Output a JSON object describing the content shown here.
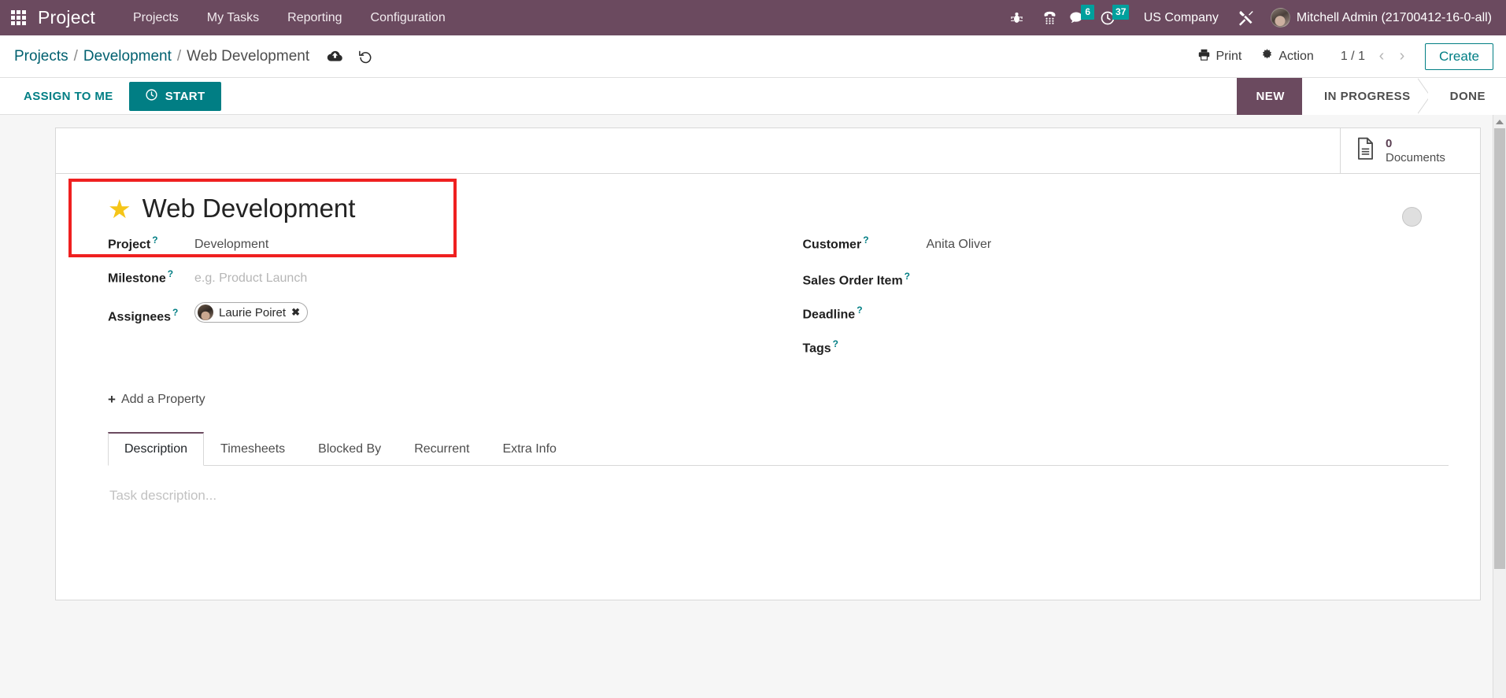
{
  "navbar": {
    "apps_icon": "apps-grid-icon",
    "brand": "Project",
    "menu_items": [
      {
        "label": "Projects"
      },
      {
        "label": "My Tasks"
      },
      {
        "label": "Reporting"
      },
      {
        "label": "Configuration"
      }
    ],
    "icons": [
      {
        "name": "bug-icon"
      },
      {
        "name": "dialpad-icon"
      }
    ],
    "messages_badge": "6",
    "activities_badge": "37",
    "company": "US Company",
    "tools_icon": "tools-icon",
    "user": "Mitchell Admin (21700412-16-0-all)",
    "colors": {
      "background": "#6b4a5f",
      "badge": "#00a09d"
    }
  },
  "control_panel": {
    "breadcrumb": [
      {
        "label": "Projects",
        "link": true
      },
      {
        "label": "Development",
        "link": true
      },
      {
        "label": "Web Development",
        "link": false
      }
    ],
    "separator": "/",
    "save_icon": "cloud-upload-icon",
    "discard_icon": "undo-icon",
    "print_label": "Print",
    "print_icon": "printer-icon",
    "action_label": "Action",
    "action_icon": "gear-icon",
    "pager": "1 / 1",
    "prev_icon": "chevron-left-icon",
    "next_icon": "chevron-right-icon",
    "create_label": "Create"
  },
  "status_row": {
    "assign_to_me": "ASSIGN TO ME",
    "start_label": "START",
    "start_icon": "clock-icon",
    "stages": [
      {
        "label": "NEW",
        "active": true
      },
      {
        "label": "IN PROGRESS",
        "active": false
      },
      {
        "label": "DONE",
        "active": false
      }
    ],
    "accent": "#017e84",
    "active_stage_color": "#6b4a5f"
  },
  "smart_buttons": [
    {
      "value": "0",
      "label": "Documents",
      "icon": "document-icon"
    }
  ],
  "form": {
    "star_icon": "star-icon",
    "task_name": "Web Development",
    "avatar_placeholder": "avatar-placeholder",
    "highlight_color": "#ef2020",
    "left_fields": [
      {
        "label": "Project",
        "tip": "?",
        "value": "Development",
        "placeholder": "",
        "type": "value"
      },
      {
        "label": "Milestone",
        "tip": "?",
        "value": "",
        "placeholder": "e.g. Product Launch",
        "type": "placeholder"
      },
      {
        "label": "Assignees",
        "tip": "?",
        "value": "",
        "placeholder": "",
        "type": "tags"
      }
    ],
    "assignee_tags": [
      {
        "name": "Laurie Poiret",
        "remove_icon": "remove-tag-icon"
      }
    ],
    "right_fields": [
      {
        "label": "Customer",
        "tip": "?",
        "value": "Anita Oliver",
        "type": "value"
      },
      {
        "label": "Sales Order Item",
        "tip": "?",
        "value": "",
        "type": "empty"
      },
      {
        "label": "Deadline",
        "tip": "?",
        "value": "",
        "type": "empty"
      },
      {
        "label": "Tags",
        "tip": "?",
        "value": "",
        "type": "empty"
      }
    ],
    "add_property": "Add a Property",
    "add_property_plus": "+"
  },
  "notebook": {
    "tabs": [
      {
        "label": "Description",
        "active": true
      },
      {
        "label": "Timesheets",
        "active": false
      },
      {
        "label": "Blocked By",
        "active": false
      },
      {
        "label": "Recurrent",
        "active": false
      },
      {
        "label": "Extra Info",
        "active": false
      }
    ],
    "description_placeholder": "Task description..."
  }
}
